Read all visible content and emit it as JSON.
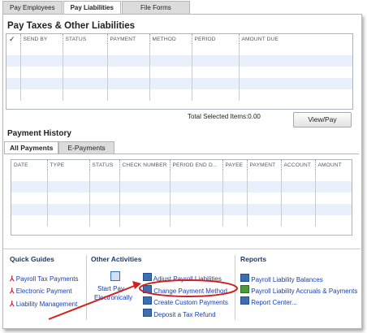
{
  "tabs": [
    {
      "label": "Pay Employees"
    },
    {
      "label": "Pay Liabilities"
    },
    {
      "label": "File Forms"
    }
  ],
  "section1": {
    "title": "Pay Taxes & Other Liabilities",
    "columns": [
      "✓",
      "SEND BY",
      "STATUS",
      "PAYMENT",
      "METHOD",
      "PERIOD",
      "AMOUNT DUE"
    ],
    "total_label": "Total Selected Items:",
    "total_value": "0.00",
    "view_pay_label": "View/Pay"
  },
  "section2": {
    "title": "Payment History",
    "tabs": [
      "All Payments",
      "E-Payments"
    ],
    "columns": [
      "DATE",
      "TYPE",
      "STATUS",
      "CHECK NUMBER",
      "PERIOD END D...",
      "PAYEE",
      "PAYMENT",
      "ACCOUNT",
      "AMOUNT"
    ]
  },
  "quick_guides": {
    "title": "Quick Guides",
    "links": [
      "Payroll Tax Payments",
      "Electronic Payment",
      "Liability Management"
    ]
  },
  "other_activities": {
    "title": "Other Activities",
    "start_label_1": "Start Pay",
    "start_label_2": "Electronically",
    "links": [
      "Adjust Payroll Liabilities",
      "Change Payment Method",
      "Create Custom Payments",
      "Deposit a Tax Refund"
    ]
  },
  "reports": {
    "title": "Reports",
    "links": [
      "Payroll Liability Balances",
      "Payroll Liability Accruals & Payments",
      "Report Center..."
    ]
  },
  "colors": {
    "accent_red": "#d0201f",
    "link_blue": "#1a3fb0",
    "row_alt": "#e8f1fb"
  }
}
